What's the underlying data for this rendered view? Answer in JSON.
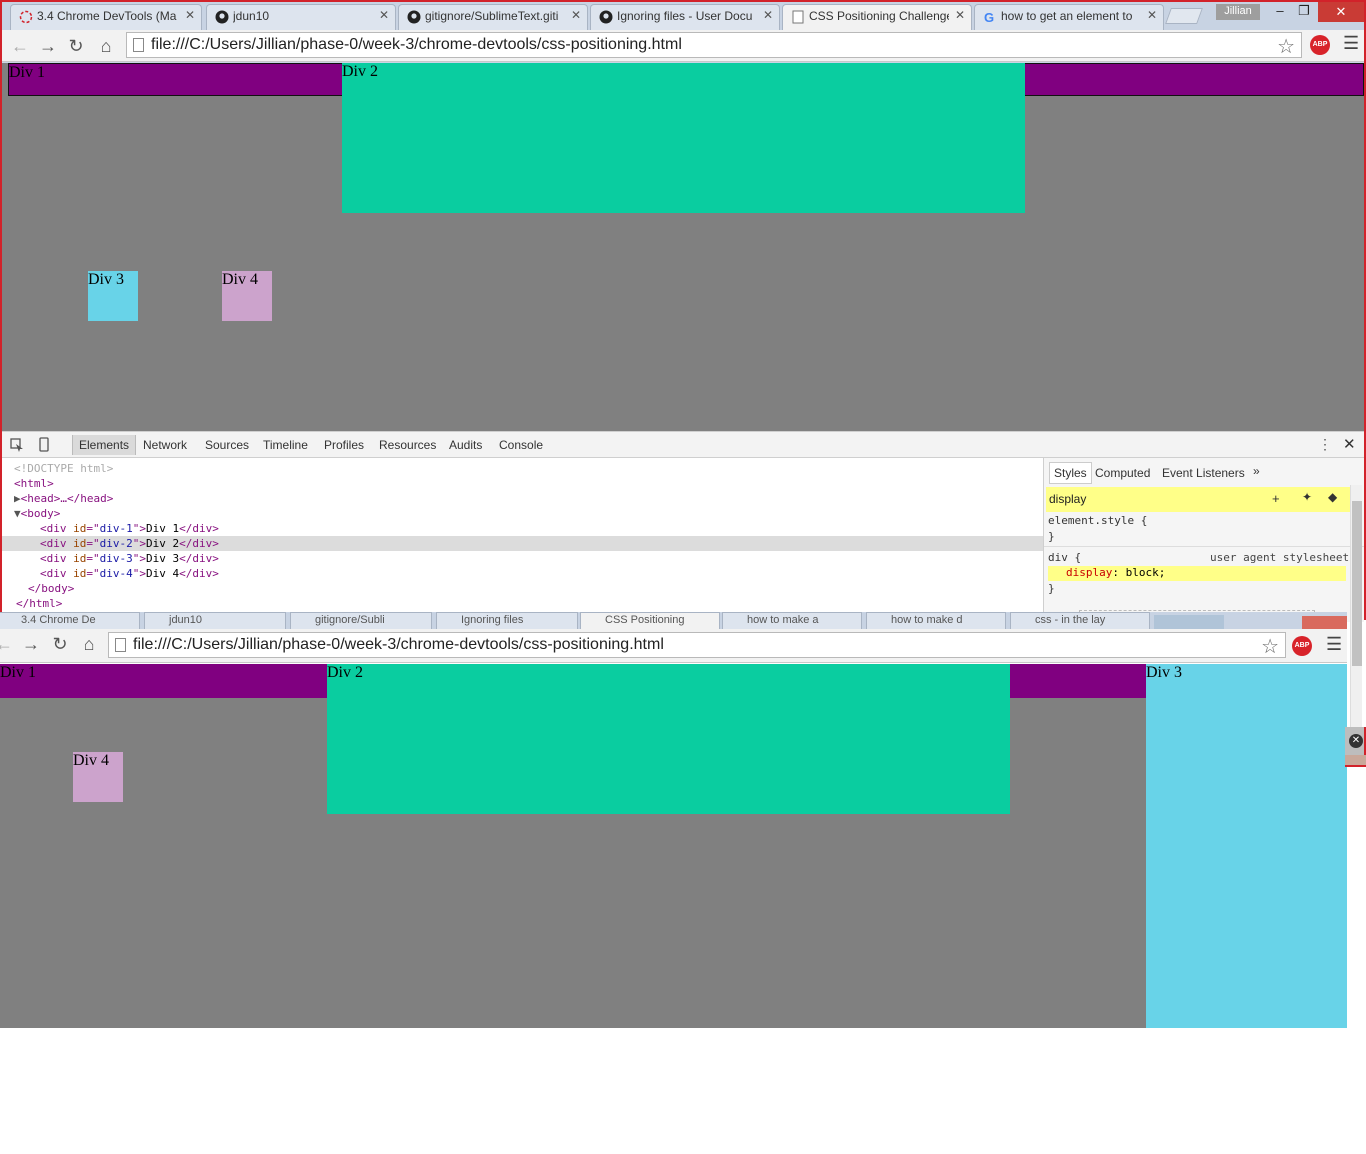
{
  "window1": {
    "tabs": [
      {
        "label": "3.4 Chrome DevTools (Ma",
        "icon": "loading-icon"
      },
      {
        "label": "jdun10",
        "icon": "github-icon"
      },
      {
        "label": "gitignore/SublimeText.giti",
        "icon": "github-icon"
      },
      {
        "label": "Ignoring files - User Docu",
        "icon": "github-icon"
      },
      {
        "label": "CSS Positioning Challenge",
        "icon": "page-icon"
      },
      {
        "label": "how to get an element to",
        "icon": "google-icon"
      }
    ],
    "user": "Jillian",
    "url": "file:///C:/Users/Jillian/phase-0/week-3/chrome-devtools/css-positioning.html"
  },
  "page1": {
    "div1": "Div 1",
    "div2": "Div 2",
    "div3": "Div 3",
    "div4": "Div 4"
  },
  "devtools": {
    "tabs": [
      "Elements",
      "Network",
      "Sources",
      "Timeline",
      "Profiles",
      "Resources",
      "Audits",
      "Console"
    ],
    "selected_tab": "Elements",
    "dom": {
      "doctype": "<!DOCTYPE html>",
      "html_open": "<html>",
      "head": "<head>…</head>",
      "body_open": "<body>",
      "body_close": "</body>",
      "html_close": "</html>",
      "divs": [
        {
          "id": "div-1",
          "text": "Div 1"
        },
        {
          "id": "div-2",
          "text": "Div 2"
        },
        {
          "id": "div-3",
          "text": "Div 3"
        },
        {
          "id": "div-4",
          "text": "Div 4"
        }
      ]
    },
    "styles_tabs": [
      "Styles",
      "Computed",
      "Event Listeners"
    ],
    "filter_value": "display",
    "element_style": "element.style {",
    "rule_selector": "div {",
    "rule_source": "user agent stylesheet",
    "rule_prop": "display",
    "rule_value": "block;",
    "close_brace": "}"
  },
  "window2": {
    "tabs": [
      "3.4 Chrome De",
      "jdun10",
      "gitignore/Subli",
      "Ignoring files",
      "CSS Positioning",
      "how to make a",
      "how to make d",
      "css - in the lay"
    ],
    "url": "file:///C:/Users/Jillian/phase-0/week-3/chrome-devtools/css-positioning.html"
  },
  "page2": {
    "div1": "Div 1",
    "div2": "Div 2",
    "div3": "Div 3",
    "div4": "Div 4"
  },
  "colors": {
    "div1": "#800080",
    "div2": "#0acda0",
    "div3": "#68d3e8",
    "div4": "#cca3cc",
    "page_bg": "#808080"
  }
}
